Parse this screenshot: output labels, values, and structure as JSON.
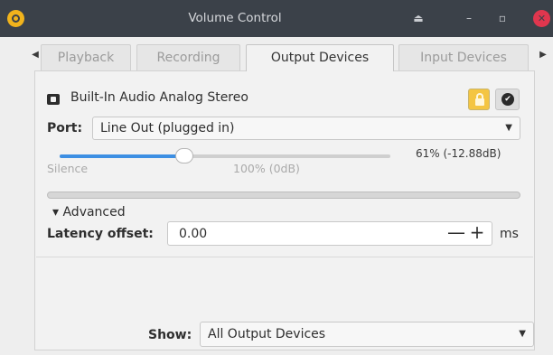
{
  "window": {
    "title": "Volume Control"
  },
  "titlebar_buttons": {
    "eject": "⏏",
    "minimize": "–",
    "maximize": "▫",
    "close": "✕"
  },
  "tabs": [
    {
      "label": "Playback",
      "active": false
    },
    {
      "label": "Recording",
      "active": false
    },
    {
      "label": "Output Devices",
      "active": true
    },
    {
      "label": "Input Devices",
      "active": false
    }
  ],
  "device": {
    "name": "Built-In Audio Analog Stereo",
    "lock_icon": "lock-icon",
    "default_icon": "checkmark-icon"
  },
  "port": {
    "label": "Port:",
    "value": "Line Out (plugged in)"
  },
  "volume": {
    "percent": 61,
    "readout": "61% (-12.88dB)",
    "silence_label": "Silence",
    "full_label": "100% (0dB)"
  },
  "advanced": {
    "label": "▾ Advanced",
    "latency_label": "Latency offset:",
    "latency_value": "0.00",
    "unit": "ms",
    "minus": "—",
    "plus": "+"
  },
  "show": {
    "label": "Show:",
    "value": "All Output Devices"
  },
  "colors": {
    "titlebar": "#3b4149",
    "accent": "#3d8fe3",
    "close": "#e0364e",
    "app_icon": "#f1b31c"
  }
}
